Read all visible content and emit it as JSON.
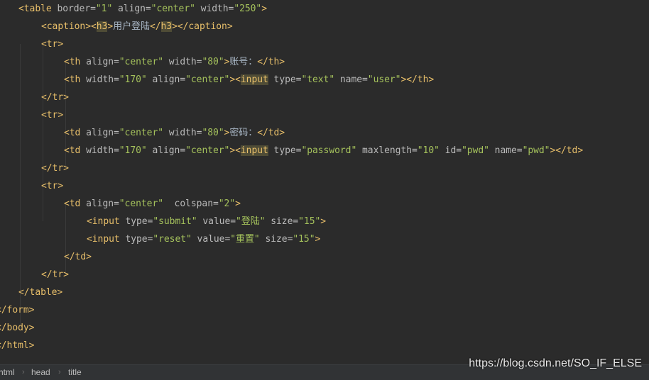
{
  "editor": {
    "lines": [
      {
        "indent": 1,
        "tokens": [
          [
            "tag",
            "<table"
          ],
          [
            "attr",
            " border="
          ],
          [
            "str",
            "\"1\""
          ],
          [
            "attr",
            " align="
          ],
          [
            "str",
            "\"center\""
          ],
          [
            "attr",
            " width="
          ],
          [
            "str",
            "\"250\""
          ],
          [
            "tag",
            ">"
          ]
        ]
      },
      {
        "indent": 2,
        "tokens": [
          [
            "tag",
            "<caption><"
          ],
          [
            "hl",
            "h3"
          ],
          [
            "tag",
            ">"
          ],
          [
            "text",
            "用户登陆"
          ],
          [
            "tag",
            "</"
          ],
          [
            "hl",
            "h3"
          ],
          [
            "tag",
            "></caption>"
          ]
        ]
      },
      {
        "indent": 2,
        "tokens": [
          [
            "tag",
            "<tr>"
          ]
        ]
      },
      {
        "indent": 3,
        "tokens": [
          [
            "tag",
            "<th"
          ],
          [
            "attr",
            " align="
          ],
          [
            "str",
            "\"center\""
          ],
          [
            "attr",
            " width="
          ],
          [
            "str",
            "\"80\""
          ],
          [
            "tag",
            ">"
          ],
          [
            "text",
            "账号："
          ],
          [
            "tag",
            "</th>"
          ]
        ]
      },
      {
        "indent": 3,
        "tokens": [
          [
            "tag",
            "<th"
          ],
          [
            "attr",
            " width="
          ],
          [
            "str",
            "\"170\""
          ],
          [
            "attr",
            " align="
          ],
          [
            "str",
            "\"center\""
          ],
          [
            "tag",
            "><"
          ],
          [
            "hl",
            "input"
          ],
          [
            "attr",
            " type="
          ],
          [
            "str",
            "\"text\""
          ],
          [
            "attr",
            " name="
          ],
          [
            "str",
            "\"user\""
          ],
          [
            "tag",
            "></th>"
          ]
        ]
      },
      {
        "indent": 2,
        "tokens": [
          [
            "tag",
            "</tr>"
          ]
        ]
      },
      {
        "indent": 2,
        "tokens": [
          [
            "tag",
            "<tr>"
          ]
        ]
      },
      {
        "indent": 3,
        "tokens": [
          [
            "tag",
            "<td"
          ],
          [
            "attr",
            " align="
          ],
          [
            "str",
            "\"center\""
          ],
          [
            "attr",
            " width="
          ],
          [
            "str",
            "\"80\""
          ],
          [
            "tag",
            ">"
          ],
          [
            "text",
            "密码："
          ],
          [
            "tag",
            "</td>"
          ]
        ]
      },
      {
        "indent": 3,
        "tokens": [
          [
            "tag",
            "<td"
          ],
          [
            "attr",
            " width="
          ],
          [
            "str",
            "\"170\""
          ],
          [
            "attr",
            " align="
          ],
          [
            "str",
            "\"center\""
          ],
          [
            "tag",
            "><"
          ],
          [
            "hl",
            "input"
          ],
          [
            "attr",
            " type="
          ],
          [
            "str",
            "\"password\""
          ],
          [
            "attr",
            " maxlength="
          ],
          [
            "str",
            "\"10\""
          ],
          [
            "attr",
            " id="
          ],
          [
            "str",
            "\"pwd\""
          ],
          [
            "attr",
            " name="
          ],
          [
            "str",
            "\"pwd\""
          ],
          [
            "tag",
            "></td>"
          ]
        ]
      },
      {
        "indent": 2,
        "tokens": [
          [
            "tag",
            "</tr>"
          ]
        ]
      },
      {
        "indent": 2,
        "tokens": [
          [
            "tag",
            "<tr>"
          ]
        ]
      },
      {
        "indent": 3,
        "tokens": [
          [
            "tag",
            "<td"
          ],
          [
            "attr",
            " align="
          ],
          [
            "str",
            "\"center\""
          ],
          [
            "attr",
            "  colspan="
          ],
          [
            "str",
            "\"2\""
          ],
          [
            "tag",
            ">"
          ]
        ]
      },
      {
        "indent": 4,
        "tokens": [
          [
            "tag",
            "<input"
          ],
          [
            "attr",
            " type="
          ],
          [
            "str",
            "\"submit\""
          ],
          [
            "attr",
            " value="
          ],
          [
            "str",
            "\"登陆\""
          ],
          [
            "attr",
            " size="
          ],
          [
            "str",
            "\"15\""
          ],
          [
            "tag",
            ">"
          ]
        ]
      },
      {
        "indent": 4,
        "tokens": [
          [
            "tag",
            "<input"
          ],
          [
            "attr",
            " type="
          ],
          [
            "str",
            "\"reset\""
          ],
          [
            "attr",
            " value="
          ],
          [
            "str",
            "\"重置\""
          ],
          [
            "attr",
            " size="
          ],
          [
            "str",
            "\"15\""
          ],
          [
            "tag",
            ">"
          ]
        ]
      },
      {
        "indent": 3,
        "tokens": [
          [
            "tag",
            "</td>"
          ]
        ]
      },
      {
        "indent": 2,
        "tokens": [
          [
            "tag",
            "</tr>"
          ]
        ]
      },
      {
        "indent": 1,
        "tokens": [
          [
            "tag",
            "</table>"
          ]
        ]
      },
      {
        "indent": 0,
        "tokens": [
          [
            "tag",
            "</form>"
          ]
        ]
      },
      {
        "indent": 0,
        "tokens": [
          [
            "tag",
            "</body>"
          ]
        ]
      },
      {
        "indent": 0,
        "tokens": [
          [
            "tag",
            "</html>"
          ]
        ]
      }
    ]
  },
  "breadcrumb": [
    "html",
    "head",
    "title"
  ],
  "watermark": "https://blog.csdn.net/SO_IF_ELSE"
}
